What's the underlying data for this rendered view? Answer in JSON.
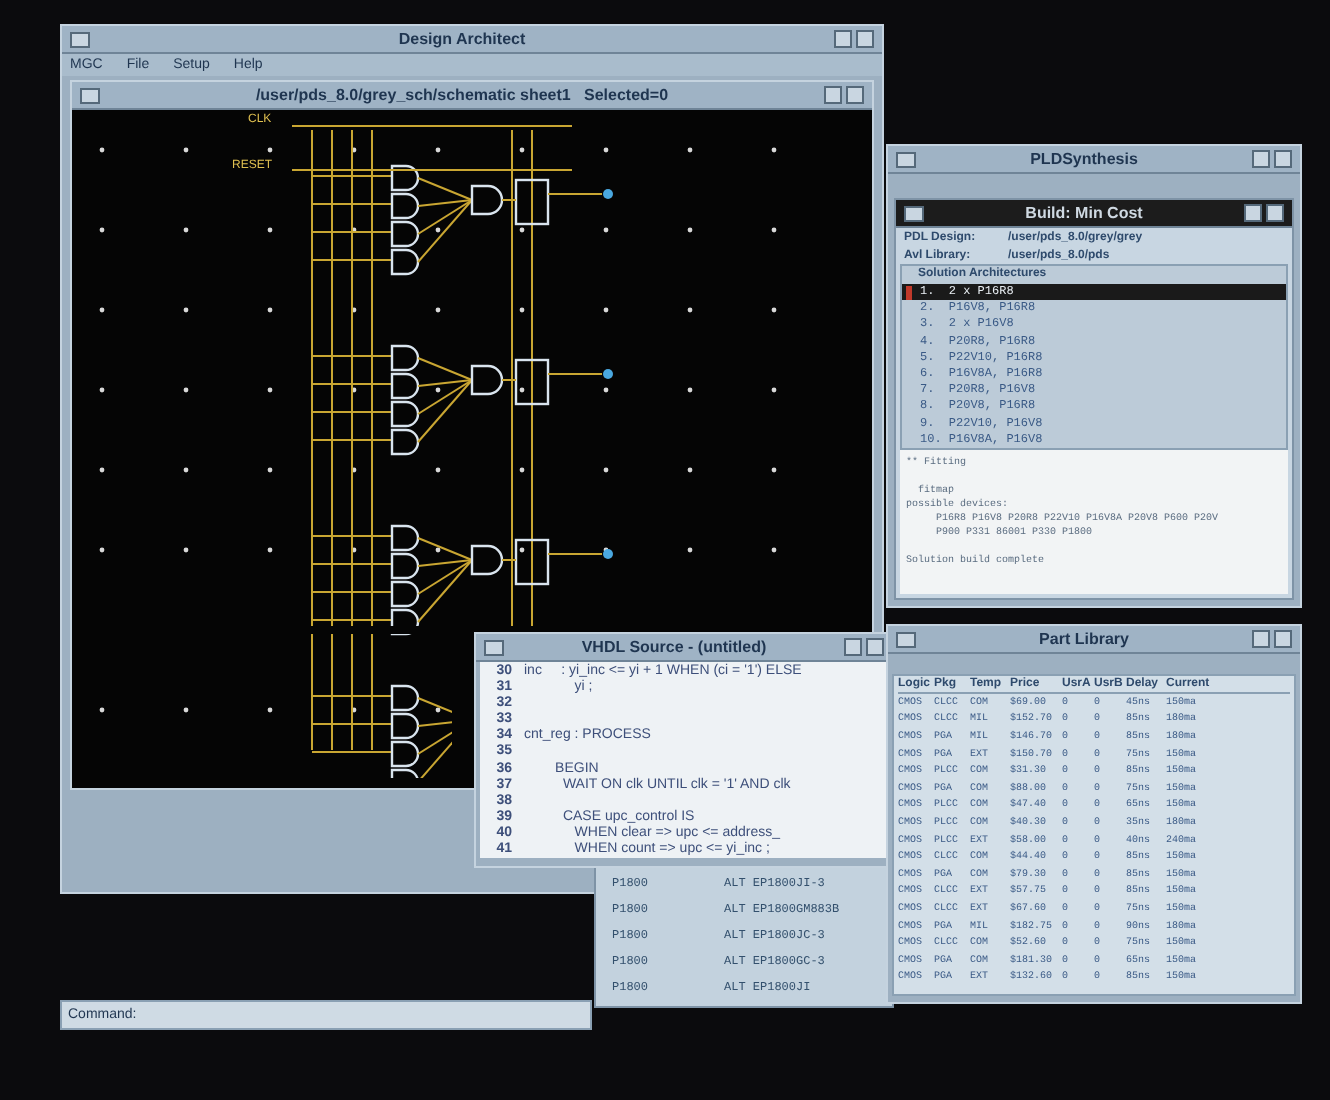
{
  "design_window": {
    "title": "Design Architect",
    "menu": [
      "MGC",
      "File",
      "Setup",
      "Help"
    ],
    "schematic": {
      "title": "/user/pds_8.0/grey_sch/schematic sheet1   Selected=0",
      "labels": [
        "CLK",
        "RESET"
      ]
    }
  },
  "synthesis_window": {
    "title": "PLDSynthesis",
    "build": {
      "title": "Build: Min Cost",
      "fields": [
        {
          "label": "PDL Design:",
          "value": "/user/pds_8.0/grey/grey"
        },
        {
          "label": "Avl Library:",
          "value": "/user/pds_8.0/pds"
        }
      ],
      "list_title": "Solution Architectures",
      "solutions": [
        {
          "text": "1.  2 x P16R8",
          "selected": true
        },
        {
          "text": "2.  P16V8, P16R8",
          "selected": false
        },
        {
          "text": "3.  2 x P16V8",
          "selected": false
        },
        {
          "text": "4.  P20R8, P16R8",
          "selected": false
        },
        {
          "text": "5.  P22V10, P16R8",
          "selected": false
        },
        {
          "text": "6.  P16V8A, P16R8",
          "selected": false
        },
        {
          "text": "7.  P20R8, P16V8",
          "selected": false
        },
        {
          "text": "8.  P20V8, P16R8",
          "selected": false
        },
        {
          "text": "9.  P22V10, P16V8",
          "selected": false
        },
        {
          "text": "10. P16V8A, P16V8",
          "selected": false
        }
      ],
      "log": [
        {
          "text": "** Fitting"
        },
        {
          "text": "  fitmap",
          "blank_before": true
        },
        {
          "text": "possible devices:"
        },
        {
          "text": "     P16R8 P16V8 P20R8 P22V10 P16V8A P20V8 P600 P20V"
        },
        {
          "text": "     P900 P331 86001 P330 P1800"
        },
        {
          "text": "Solution build complete",
          "blank_before": true
        }
      ]
    }
  },
  "vhdl_window": {
    "title": "VHDL Source - (untitled)",
    "lines": [
      {
        "number": "30",
        "code": "inc     : yi_inc <= yi + 1 WHEN (ci = '1') ELSE"
      },
      {
        "number": "31",
        "code": "             yi ;"
      },
      {
        "number": "32"
      },
      {
        "number": "33"
      },
      {
        "number": "34",
        "code": "cnt_reg : PROCESS"
      },
      {
        "number": "35"
      },
      {
        "number": "36",
        "code": "        BEGIN"
      },
      {
        "number": "37",
        "code": "          WAIT ON clk UNTIL clk = '1' AND clk"
      },
      {
        "number": "38"
      },
      {
        "number": "39",
        "code": "          CASE upc_control IS"
      },
      {
        "number": "40",
        "code": "             WHEN clear => upc <= address_"
      },
      {
        "number": "41",
        "code": "             WHEN count => upc <= yi_inc ;"
      }
    ]
  },
  "device_list": {
    "rows": [
      [
        "P1800",
        "ALT EP1800JI-3"
      ],
      [
        "P1800",
        "ALT EP1800GM883B"
      ],
      [
        "P1800",
        "ALT EP1800JC-3"
      ],
      [
        "P1800",
        "ALT EP1800GC-3"
      ],
      [
        "P1800",
        "ALT EP1800JI"
      ]
    ]
  },
  "part_library": {
    "title": "Part Library",
    "columns": [
      "Logic",
      "Pkg",
      "Temp",
      "Price",
      "UsrA",
      "UsrB",
      "Delay",
      "Current"
    ],
    "rows": [
      [
        "CMOS",
        "CLCC",
        "COM",
        "$69.00",
        "0",
        "0",
        "45ns",
        "150ma"
      ],
      [
        "CMOS",
        "CLCC",
        "MIL",
        "$152.70",
        "0",
        "0",
        "85ns",
        "180ma"
      ],
      [
        "CMOS",
        "PGA",
        "MIL",
        "$146.70",
        "0",
        "0",
        "85ns",
        "180ma"
      ],
      [
        "CMOS",
        "PGA",
        "EXT",
        "$150.70",
        "0",
        "0",
        "75ns",
        "150ma"
      ],
      [
        "CMOS",
        "PLCC",
        "COM",
        "$31.30",
        "0",
        "0",
        "85ns",
        "150ma"
      ],
      [
        "CMOS",
        "PGA",
        "COM",
        "$88.00",
        "0",
        "0",
        "75ns",
        "150ma"
      ],
      [
        "CMOS",
        "PLCC",
        "COM",
        "$47.40",
        "0",
        "0",
        "65ns",
        "150ma"
      ],
      [
        "CMOS",
        "PLCC",
        "COM",
        "$40.30",
        "0",
        "0",
        "35ns",
        "180ma"
      ],
      [
        "CMOS",
        "PLCC",
        "EXT",
        "$58.00",
        "0",
        "0",
        "40ns",
        "240ma"
      ],
      [
        "CMOS",
        "CLCC",
        "COM",
        "$44.40",
        "0",
        "0",
        "85ns",
        "150ma"
      ],
      [
        "CMOS",
        "PGA",
        "COM",
        "$79.30",
        "0",
        "0",
        "85ns",
        "150ma"
      ],
      [
        "CMOS",
        "CLCC",
        "EXT",
        "$57.75",
        "0",
        "0",
        "85ns",
        "150ma"
      ],
      [
        "CMOS",
        "CLCC",
        "EXT",
        "$67.60",
        "0",
        "0",
        "75ns",
        "150ma"
      ],
      [
        "CMOS",
        "PGA",
        "MIL",
        "$182.75",
        "0",
        "0",
        "90ns",
        "180ma"
      ],
      [
        "CMOS",
        "CLCC",
        "COM",
        "$52.60",
        "0",
        "0",
        "75ns",
        "150ma"
      ],
      [
        "CMOS",
        "PGA",
        "COM",
        "$181.30",
        "0",
        "0",
        "65ns",
        "150ma"
      ],
      [
        "CMOS",
        "PGA",
        "EXT",
        "$132.60",
        "0",
        "0",
        "85ns",
        "150ma"
      ]
    ]
  },
  "command_bar": {
    "label": "Command:"
  }
}
